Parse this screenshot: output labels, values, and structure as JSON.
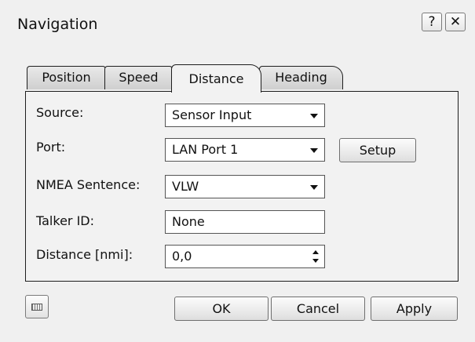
{
  "window": {
    "title": "Navigation",
    "help_label": "?",
    "close_label": "✕"
  },
  "tabs": [
    {
      "label": "Position",
      "active": false
    },
    {
      "label": "Speed",
      "active": false
    },
    {
      "label": "Distance",
      "active": true
    },
    {
      "label": "Heading",
      "active": false
    }
  ],
  "form": {
    "source": {
      "label": "Source:",
      "value": "Sensor Input"
    },
    "port": {
      "label": "Port:",
      "value": "LAN Port 1"
    },
    "nmea": {
      "label": "NMEA Sentence:",
      "value": "VLW"
    },
    "talker": {
      "label": "Talker ID:",
      "value": "None"
    },
    "distance": {
      "label": "Distance [nmi]:",
      "value": "0,0"
    },
    "setup_label": "Setup"
  },
  "footer": {
    "keyboard_icon": "keyboard-icon",
    "ok_label": "OK",
    "cancel_label": "Cancel",
    "apply_label": "Apply"
  }
}
